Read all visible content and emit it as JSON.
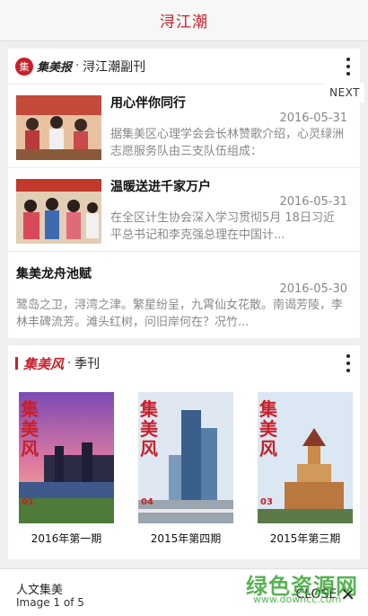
{
  "header": {
    "title": "浔江潮"
  },
  "news_card": {
    "brand": "集美报",
    "separator": "·",
    "section": "浔江潮副刊",
    "next_label": "NEXT",
    "articles": [
      {
        "title": "用心伴你同行",
        "date": "2016-05-31",
        "desc": "据集美区心理学会会长林赞歌介绍，心灵绿洲志愿服务队由三支队伍组成："
      },
      {
        "title": "温暖送进千家万户",
        "date": "2016-05-31",
        "desc": "在全区计生协会深入学习贯彻5月 18日习近平总书记和李克强总理在中国计..."
      },
      {
        "title": "集美龙舟池赋",
        "date": "2016-05-30",
        "desc": "鹭岛之卫，浔湾之津。繁星纷呈，九霄仙女花散。南谒芳陵，李林丰碑流芳。滩头红树，问旧岸何在？况竹..."
      }
    ]
  },
  "magazine_card": {
    "brand": "集美风",
    "separator": "·",
    "section": "季刊",
    "covers": [
      {
        "caption": "2016年第一期",
        "issue": "01",
        "mast": "集美风"
      },
      {
        "caption": "2015年第四期",
        "issue": "04",
        "mast": "集美风"
      },
      {
        "caption": "2015年第三期",
        "issue": "03",
        "mast": "集美风"
      }
    ]
  },
  "viewer": {
    "caption_title": "人文集美",
    "caption_count": "Image 1 of 5",
    "close_label": "CLOSE"
  },
  "watermark": {
    "main": "绿色资源网",
    "url": "www.downcc.com"
  },
  "colors": {
    "accent_red": "#c8202a",
    "watermark_green": "#3aa835"
  }
}
